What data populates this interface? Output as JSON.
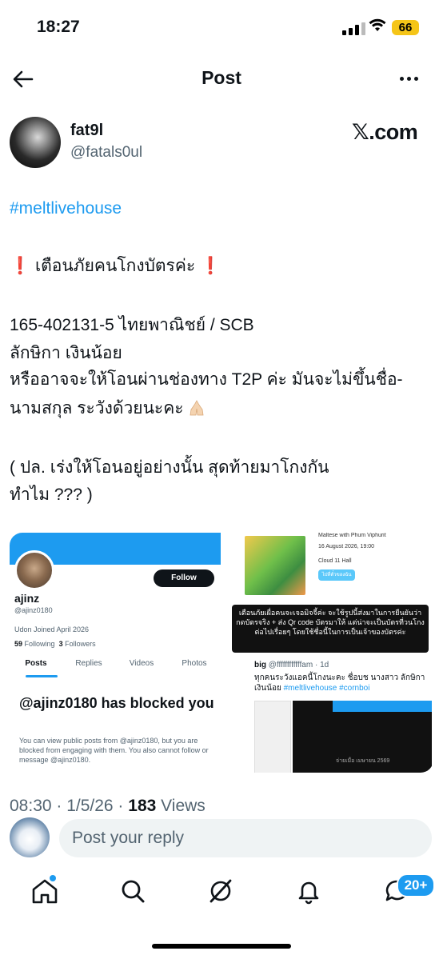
{
  "status_bar": {
    "time": "18:27",
    "battery": "66"
  },
  "nav": {
    "title": "Post"
  },
  "author": {
    "name": "fat9l",
    "handle": "@fatals0ul",
    "source_badge": "𝕏.com"
  },
  "post": {
    "hashtag": "#meltlivehouse",
    "warning": " เตือนภัยคนโกงบัตรค่ะ ",
    "account_line": "165-402131-5 ไทยพาณิชย์ / SCB",
    "name_line": "ลักษิกา เงินน้อย",
    "t2p_line": "หรืออาจจะให้โอนผ่านช่องทาง T2P ค่ะ มันจะไม่ขึ้นชื่อ-",
    "surname_line": "นามสกุล ระวังด้วยนะคะ",
    "note_line1": "( ปล. เร่งให้โอนอยู่อย่างนั้น สุดท้ายมาโกงกัน",
    "note_line2": "ทำไม ??? )"
  },
  "media": {
    "left": {
      "follow_label": "Follow",
      "name": "ajinz",
      "handle": "@ajinz0180",
      "meta": "Udon   Joined April 2026",
      "following": "59",
      "following_label": "Following",
      "followers": "3",
      "followers_label": "Followers",
      "tabs": [
        "Posts",
        "Replies",
        "Videos",
        "Photos"
      ],
      "blocked_title": "@ajinz0180 has blocked you",
      "blocked_desc": "You can view public posts from @ajinz0180, but you are blocked from engaging with them. You also cannot follow or message @ajinz0180."
    },
    "right": {
      "event_title": "Maltese with Phum Viphurit",
      "event_date": "16 August 2026, 19:00",
      "event_venue": "Cloud 11 Hall",
      "ticket_label": "ไปที่ตั๋วของฉัน",
      "warning_text": "เตือนภัยเผื่อคนจะเจอมิจจี้ค่ะ จะใช้รูปนี้ส่งมาในการยืนยันว่ากดบัตรจริง + ส่ง Qr code บัตรมาให้ แต่น่าจะเป็นบัตรที่วนโกงต่อไปเรื่อยๆ โดยใช้ชื่อนี้ในการเป็นเจ้าของบัตรค่ะ",
      "quote_name": "big",
      "quote_handle": "@ffffffffffffam",
      "quote_time": "1d",
      "quote_text": "ทุกคนระวังแอคนี้โกงนะคะ ชื่อบช นางสาว ลักษิกา เงินน้อย",
      "quote_tags": "#meltlivehouse #cornboi",
      "quote_img_date": "จ่ายเมื่อ เมษายน 2569"
    }
  },
  "meta": {
    "time": "08:30 · 1/5/26 · ",
    "views": "183",
    "views_label": " Views"
  },
  "reply": {
    "placeholder": "Post your reply"
  },
  "tabbar": {
    "badge": "20+"
  },
  "colors": {
    "accent": "#1d9bf0",
    "warning": "#e0245e",
    "battery": "#f5c518"
  }
}
